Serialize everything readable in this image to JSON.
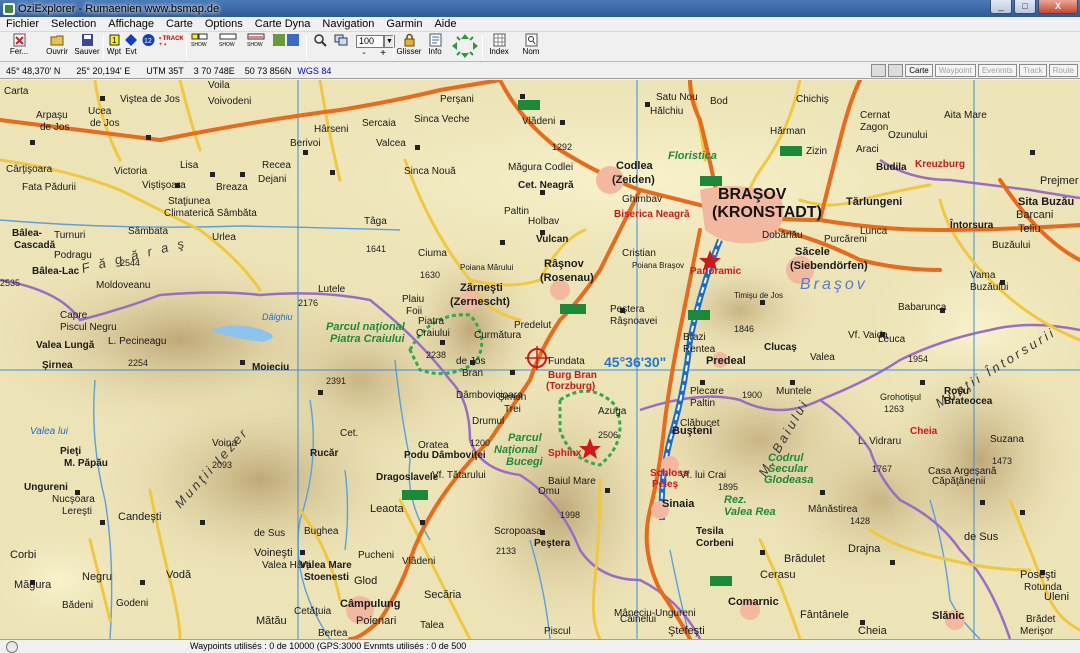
{
  "window": {
    "title": "OziExplorer - Rumaenien www.bsmap.de",
    "buttons": [
      "_",
      "□",
      "X"
    ]
  },
  "menu": [
    "Fichier",
    "Selection",
    "Affichage",
    "Carte",
    "Options",
    "Carte Dyna",
    "Navigation",
    "Garmin",
    "Aide"
  ],
  "toolbar": {
    "buttons": [
      {
        "id": "fer",
        "label": "Fer..."
      },
      {
        "id": "ouvrir",
        "label": "Ouvrir"
      },
      {
        "id": "sauver",
        "label": "Sauver"
      },
      {
        "id": "wpt",
        "label": "Wpt"
      },
      {
        "id": "evt",
        "label": "Evt"
      },
      {
        "id": "track",
        "label": "TRACK"
      },
      {
        "id": "show1",
        "label": "SHOW"
      },
      {
        "id": "show2",
        "label": "SHOW"
      },
      {
        "id": "show3",
        "label": "SHOW"
      },
      {
        "id": "glisser",
        "label": "Glisser"
      },
      {
        "id": "info",
        "label": "Info"
      },
      {
        "id": "index",
        "label": "Index"
      },
      {
        "id": "nom",
        "label": "Nom"
      }
    ],
    "zoom": "100",
    "zoom_plus": "+",
    "zoom_minus": "-"
  },
  "coords": {
    "lat": "45° 48,370' N",
    "lon": "25° 20,194' E",
    "utm": "UTM  35T",
    "easting": "3 70 748E",
    "northing": "50 73 856N",
    "datum": "WGS 84"
  },
  "right_tabs": [
    "Carte",
    "Waypoint",
    "Evenmts",
    "Track",
    "Route"
  ],
  "map": {
    "coord_label": "45°36'30\"",
    "cities_big": [
      "BRAŞOV",
      "(KRONSTADT)"
    ],
    "towns": [
      {
        "name": "Codlea",
        "sub": "(Zeiden)"
      },
      {
        "name": "Râşnov",
        "sub": "(Rosenau)"
      },
      {
        "name": "Zărneşti",
        "sub": "(Zernescht)"
      },
      {
        "name": "Săcele",
        "sub": "(Siebendörfen)"
      },
      {
        "name": "Predeal",
        "sub": ""
      },
      {
        "name": "Buşteni",
        "sub": ""
      },
      {
        "name": "Sinaia",
        "sub": ""
      },
      {
        "name": "Comarnic",
        "sub": ""
      },
      {
        "name": "Câmpulung",
        "sub": ""
      },
      {
        "name": "Slănic",
        "sub": ""
      }
    ],
    "red_labels": [
      "Biserica Neagră",
      "Panoramic",
      "Burg Bran",
      "(Torzburg)",
      "Sphinx",
      "Schloss",
      "Peleş",
      "Kreuzburg",
      "Cheia"
    ],
    "green_labels": [
      "Parcul naţional",
      "Piatra Craiului",
      "Parcul",
      "Naţional",
      "Bucegi",
      "Codrul",
      "Secular",
      "Glodeasa",
      "Rez.",
      "Valea Rea",
      "Floristica"
    ],
    "mountains": [
      "F ă g ă r a ş",
      "Munţii Iezer",
      "Braşov",
      "Munţii Întorsurii",
      "M. Baiului"
    ],
    "village_labels": [
      "Carta",
      "Arpaşu",
      "de Jos",
      "Ucea",
      "de Jos",
      "Viştea de Jos",
      "Voila",
      "Voivodeni",
      "Perşani",
      "Sinca Veche",
      "Vlădeni",
      "Hălchiu",
      "Satu Nou",
      "Bod",
      "Hărman",
      "Chichiş",
      "Araci",
      "Cârţişoara",
      "Fata Pădurii",
      "Victoria",
      "Viştişoara",
      "Staţiunea",
      "Climaterică Sâmbăta",
      "Lisa",
      "Breaza",
      "Recea",
      "Dejani",
      "Hârseni",
      "Berivoi",
      "Sercaia",
      "Valcea",
      "Sinca Nouă",
      "Bâlea-",
      "Cascadă",
      "Turnuri",
      "Podragu",
      "Sâmbata",
      "Urlea",
      "Ciuma",
      "Tâga",
      "Poiana Mărului",
      "Vulcan",
      "Holbav",
      "Paltin",
      "Măgura Codlei",
      "Cet. Neagră",
      "Ghimbav",
      "Cristian",
      "Poiana Braşov",
      "Bâlea-Lac",
      "Moldoveanu",
      "Vama",
      "Buzăului",
      "Lutele",
      "Plaiu",
      "Foii",
      "Piatra",
      "Craiului",
      "Curmătura",
      "Predelut",
      "Peştera",
      "Râşnoavei",
      "Timişu de Jos",
      "Dâlghiu",
      "Babarunca",
      "Vf. Vaida",
      "Valea",
      "Capre",
      "Piscul Negru",
      "Valea Lungă",
      "L. Pecineagu",
      "Păpuşa",
      "Moieciu",
      "de Jos",
      "Bran",
      "Fundata",
      "Drumul",
      "Şimon",
      "Trei",
      "Brazi",
      "Rentea",
      "Clucaş",
      "Leuca",
      "Şirnea",
      "Dâmbovicioara",
      "Cet.",
      "Oratea",
      "Podu Dâmboviţei",
      "Vf. Tătarului",
      "Omu",
      "Azuga",
      "Clăbucet",
      "Plecare",
      "Paltin",
      "Muntele",
      "Roşu",
      "Brateocea",
      "Grohotişul",
      "L. Vidraru",
      "Valea lui",
      "Pieţi",
      "M. Păpău",
      "Voina",
      "Rucăr",
      "Dragoslavele",
      "Leaota",
      "Scropoasa",
      "Peştera",
      "Baiul Mare",
      "Vf. Moaşa",
      "Vf. lui Crai",
      "Mânăstirea",
      "Suzana",
      "Casa Argeşană",
      "Căpăţânenii",
      "Ungureni",
      "Nucşoara",
      "Lereşti",
      "Candeşti",
      "Bughea",
      "de Sus",
      "Voineşti",
      "Valea Hârţi",
      "Pucheni",
      "Vlădeni",
      "Piscul",
      "Câinelui",
      "Tesila",
      "Corbeni",
      "Brădulet",
      "Corbi",
      "Negru",
      "Vodă",
      "Valea Mare",
      "Stoenesti",
      "Glod",
      "Secăria",
      "Mâneciu-Ungureni",
      "Cerasu",
      "Drajna",
      "de Sus",
      "Poseşti",
      "Rotunda",
      "Uleni",
      "Măgura",
      "Godeni",
      "Bădeni",
      "Mătău",
      "Cetăţuia",
      "Poienari",
      "Talea",
      "Bertea",
      "Ştefeşti",
      "Fântânele",
      "Cheia",
      "Brădet",
      "Merişor",
      "Întorsura",
      "Buzăului",
      "Sita Buzău",
      "Barcani",
      "Teliu",
      "Prejmer",
      "Budila",
      "Zizin",
      "Tărlungeni",
      "Purcăreni",
      "Dobârlău",
      "Lunca",
      "Ozunului",
      "Cernat",
      "Zagon",
      "Aita Mare"
    ],
    "peaks": [
      "2535",
      "2544",
      "2254",
      "2176",
      "1641",
      "1630",
      "2238",
      "2391",
      "2093",
      "1200",
      "1998",
      "2506",
      "1846",
      "1900",
      "1954",
      "1767",
      "1473",
      "1428",
      "2133",
      "1895",
      "1292",
      "1263"
    ],
    "roads": [
      "E68",
      "E60",
      "E574",
      "E574",
      "E60",
      "73",
      "73a",
      "73a",
      "1",
      "13",
      "37b",
      "1a",
      "10",
      "12",
      "11",
      "43",
      "21"
    ]
  },
  "status": {
    "text": "Waypoints utilisés : 0 de 10000  (GPS:3000  Evnmts utilisés : 0 de 500"
  },
  "colors": {
    "title_bg": "#3a66a4",
    "map_terrain": "#e8dfb0",
    "grid_line": "#3a8ce0",
    "major_road": "#e86a1a",
    "minor_road": "#f0c840",
    "border": "#9a6cc8",
    "national_park": "#34a84a",
    "river": "#5aa0e0"
  }
}
